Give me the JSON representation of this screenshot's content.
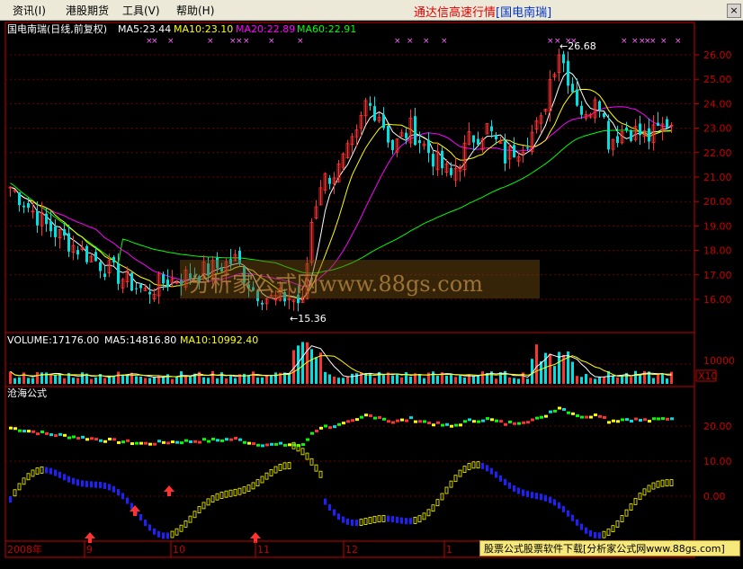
{
  "menu": [
    {
      "label": "资讯(I)"
    },
    {
      "label": "港股期货"
    },
    {
      "label": "工具(V)"
    },
    {
      "label": "帮助(H)"
    }
  ],
  "window": {
    "title_prefix": "通达信高速行情",
    "title_stock": "[国电南瑞]",
    "close_glyph": "×"
  },
  "main_panel": {
    "stock_label": "国电南瑞(日线,前复权)",
    "ma5": "MA5:23.44",
    "ma10": "MA10:23.10",
    "ma20": "MA20:22.89",
    "ma60": "MA60:22.91",
    "price_ticks": [
      "26.00",
      "25.00",
      "24.00",
      "23.00",
      "22.00",
      "21.00",
      "20.00",
      "19.00",
      "18.00",
      "17.00",
      "16.00"
    ],
    "high_marker": "←26.68",
    "low_marker": "←15.36"
  },
  "volume_panel": {
    "volume": "VOLUME:17176.00",
    "ma5": "MA5:14816.80",
    "ma10": "MA10:10992.40",
    "tick": "10000",
    "multiplier": "X10"
  },
  "indicator_panel": {
    "name": "沧海公式",
    "ticks": [
      "20.00",
      "10.00",
      "0.00"
    ]
  },
  "date_axis": [
    "2008年",
    "9",
    "10",
    "11",
    "12",
    "1"
  ],
  "watermark": "分析家公式网www.88gs.com",
  "ad_banner": "股票公式股票软件下载[分析家公式网www.88gs.com]",
  "colors": {
    "up": "#ff3232",
    "down": "#00e0e0",
    "ma5": "#ffffff",
    "ma10": "#ffff00",
    "ma20": "#ff00ff",
    "ma60": "#00ff00",
    "axis": "#c80000"
  }
}
